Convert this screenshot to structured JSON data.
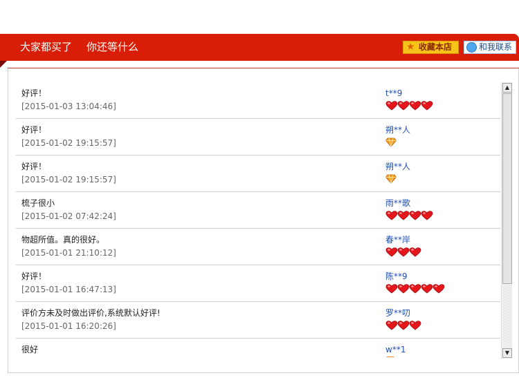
{
  "header": {
    "title_left": "大家都买了",
    "title_right": "你还等什么",
    "favorite_button": "收藏本店",
    "contact_button": "和我联系",
    "accent_color": "#d81e06"
  },
  "reviews": [
    {
      "comment": "好评！",
      "date": "[2015-01-03 13:04:46]",
      "user": "t**9",
      "rank_icon": "heart",
      "rank_count": 4
    },
    {
      "comment": "好评！",
      "date": "[2015-01-02 19:15:57]",
      "user": "朔**人",
      "rank_icon": "diamond",
      "rank_count": 1
    },
    {
      "comment": "好评！",
      "date": "[2015-01-02 19:15:57]",
      "user": "朔**人",
      "rank_icon": "diamond",
      "rank_count": 1
    },
    {
      "comment": "梳子很小",
      "date": "[2015-01-02 07:42:24]",
      "user": "雨**歌",
      "rank_icon": "heart",
      "rank_count": 4
    },
    {
      "comment": "物超所值。真的很好。",
      "date": "[2015-01-01 21:10:12]",
      "user": "春**岸",
      "rank_icon": "heart",
      "rank_count": 3
    },
    {
      "comment": "好评！",
      "date": "[2015-01-01 16:47:13]",
      "user": "陈**9",
      "rank_icon": "heart",
      "rank_count": 5
    },
    {
      "comment": "评价方未及时做出评价,系统默认好评!",
      "date": "[2015-01-01 16:20:26]",
      "user": "罗**叨",
      "rank_icon": "heart",
      "rank_count": 3
    },
    {
      "comment": "很好",
      "date": "",
      "user": "w**1",
      "rank_icon": "heart",
      "rank_count": 0
    }
  ]
}
